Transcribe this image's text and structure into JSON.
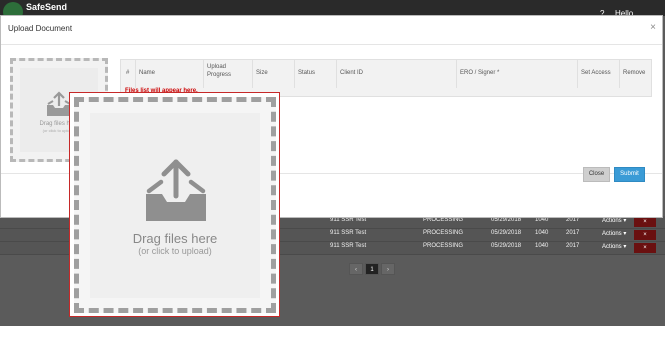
{
  "app": {
    "logo_text": "SafeSend",
    "header_right_1": "?",
    "header_right_2": "Hello, ________"
  },
  "background_table": {
    "rows": [
      {
        "client": "911 SSR Test",
        "status": "PROCESSING",
        "date": "05/29/2018",
        "form": "1040",
        "year": "2017",
        "actions": "Actions ▾"
      },
      {
        "client": "911 SSR Test",
        "status": "PROCESSING",
        "date": "05/29/2018",
        "form": "1040",
        "year": "2017",
        "actions": "Actions ▾"
      },
      {
        "client": "911 SSR Test",
        "status": "PROCESSING",
        "date": "05/29/2018",
        "form": "1040",
        "year": "2017",
        "actions": "Actions ▾"
      }
    ],
    "delete_label": "×",
    "pager": {
      "prev": "‹",
      "page": "1",
      "next": "›"
    }
  },
  "modal": {
    "title": "Upload Document",
    "close_symbol": "×",
    "close_button": "Close",
    "submit_button": "Submit"
  },
  "dropzone_small": {
    "title": "Drag files here",
    "subtitle": "(or click to upload)"
  },
  "file_table": {
    "headers": [
      "#",
      "Name",
      "Upload Progress",
      "Size",
      "Status",
      "Client ID",
      "ERO / Signer *",
      "Set Access",
      "Remove"
    ],
    "empty_note": "Files list will appear here."
  },
  "dropzone_zoom": {
    "title": "Drag files here",
    "subtitle": "(or click to upload)"
  },
  "colors": {
    "submit": "#3a9bd6",
    "zoom_border": "#c62828",
    "delete": "#6a1010"
  }
}
